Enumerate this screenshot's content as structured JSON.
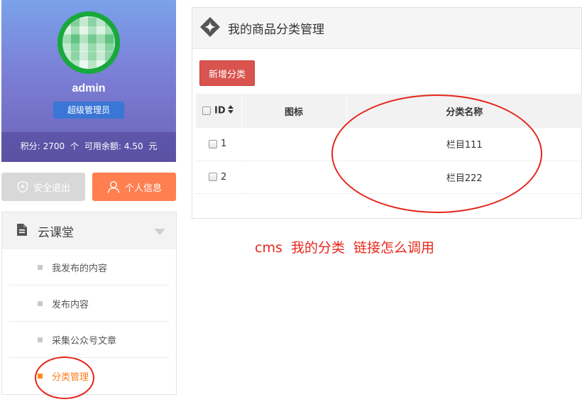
{
  "profile": {
    "username": "admin",
    "role": "超级管理员",
    "points_label": "积分:",
    "points_value": "2700",
    "points_unit": "个",
    "balance_label": "可用余额:",
    "balance_value": "4.50",
    "balance_unit": "元"
  },
  "actions": {
    "logout_label": "安全退出",
    "profile_label": "个人信息"
  },
  "menu": {
    "title": "云课堂",
    "items": [
      {
        "label": "我发布的内容",
        "active": false
      },
      {
        "label": "发布内容",
        "active": false
      },
      {
        "label": "采集公众号文章",
        "active": false
      },
      {
        "label": "分类管理",
        "active": true
      }
    ]
  },
  "panel": {
    "title": "我的商品分类管理",
    "add_button": "新增分类",
    "columns": {
      "id": "ID",
      "icon": "图标",
      "name": "分类名称"
    },
    "rows": [
      {
        "id": "1",
        "icon": "",
        "name": "栏目111"
      },
      {
        "id": "2",
        "icon": "",
        "name": "栏目222"
      }
    ]
  },
  "annotation": "cms  我的分类  链接怎么调用",
  "colors": {
    "accent_orange": "#ff7f50",
    "danger_red": "#d9534f",
    "role_blue": "#3a76d6",
    "annotation_red": "#e8281b"
  }
}
